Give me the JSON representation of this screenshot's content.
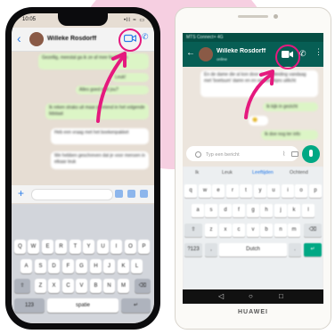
{
  "contact_name": "Willeke Rosdorff",
  "ios": {
    "time": "10:05",
    "status_right": "•ll ≈ ▭",
    "keyboard_space": "spatie",
    "rows": [
      [
        "Q",
        "W",
        "E",
        "R",
        "T",
        "Y",
        "U",
        "I",
        "O",
        "P"
      ],
      [
        "A",
        "S",
        "D",
        "F",
        "G",
        "H",
        "J",
        "K",
        "L"
      ],
      [
        "Z",
        "X",
        "C",
        "V",
        "B",
        "N",
        "M"
      ]
    ],
    "messages": [
      {
        "side": "out",
        "text": "Gezellig, meestal ga ik ze af mee faciliteren"
      },
      {
        "side": "out",
        "text": "Leuk!"
      },
      {
        "side": "out",
        "text": "Alles goed met jou?"
      },
      {
        "side": "out",
        "text": "Ik reken straks uit maar je vriend in het volgende lidstaat"
      },
      {
        "side": "in",
        "text": "Heb een vraag met het boekenpakket"
      },
      {
        "side": "in",
        "text": "We hebben geschreven dat je voor mensen in elkaar leuk"
      }
    ]
  },
  "huawei": {
    "status_left": "MTS Connect+ 4G",
    "header_sub": "online",
    "input_placeholder": "Typ een bericht",
    "suggestions": [
      "Ik",
      "Leuk",
      "Leeftijden",
      "Ochtend"
    ],
    "rows": [
      [
        "q",
        "w",
        "e",
        "r",
        "t",
        "y",
        "u",
        "i",
        "o",
        "p"
      ],
      [
        "a",
        "s",
        "d",
        "f",
        "g",
        "h",
        "j",
        "k",
        "l"
      ],
      [
        "z",
        "x",
        "c",
        "v",
        "b",
        "n",
        "m"
      ]
    ],
    "space_label": "Dutch",
    "messages": [
      {
        "side": "in",
        "text": "En de dame die al kon door de rondleiding vandaag met 'boetsum' damn en en seksboekjes uitlicht"
      },
      {
        "side": "out",
        "text": "Ik kijk in gezicht"
      },
      {
        "side": "in",
        "text": "😊"
      },
      {
        "side": "out",
        "text": "Ik doe nog ter info"
      }
    ],
    "brand": "HUAWEI"
  },
  "colors": {
    "highlight": "#e5197e",
    "whatsapp_green": "#075e54",
    "ios_blue": "#2b7de9"
  }
}
